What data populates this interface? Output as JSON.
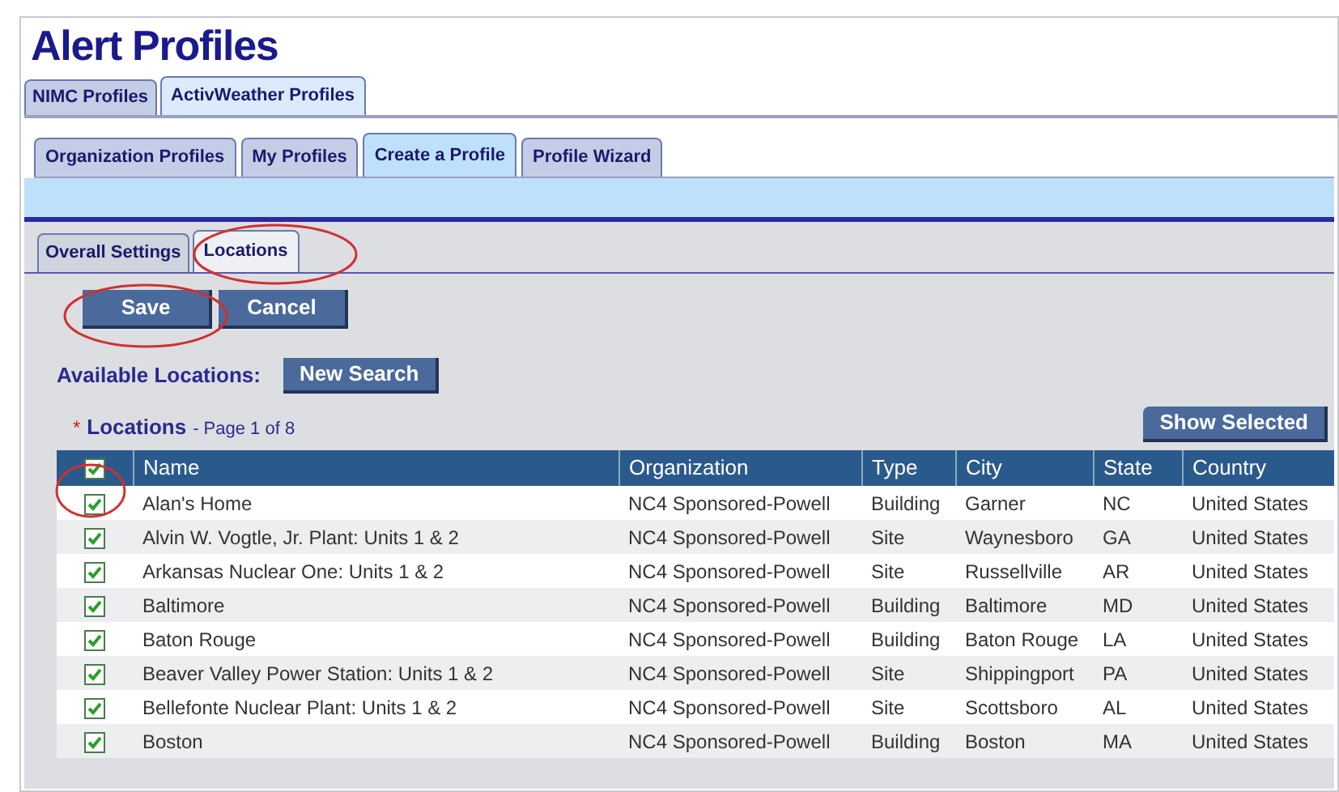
{
  "title": "Alert Profiles",
  "top_tabs": [
    {
      "label": "NIMC Profiles",
      "selected": false
    },
    {
      "label": "ActivWeather Profiles",
      "selected": true
    }
  ],
  "profile_tabs": [
    {
      "label": "Organization Profiles",
      "selected": false
    },
    {
      "label": "My Profiles",
      "selected": false
    },
    {
      "label": "Create a Profile",
      "selected": true
    },
    {
      "label": "Profile Wizard",
      "selected": false
    }
  ],
  "sub_tabs": [
    {
      "label": "Overall Settings",
      "selected": false
    },
    {
      "label": "Locations",
      "selected": true
    }
  ],
  "buttons": [
    "Save",
    "Cancel"
  ],
  "available_label": "Available Locations:",
  "new_search": "New Search",
  "required_mark": "*",
  "locations_title": "Locations",
  "page_info": "- Page 1 of 8",
  "show_selected": "Show Selected",
  "table": {
    "all_checked": true,
    "columns": [
      "Name",
      "Organization",
      "Type",
      "City",
      "State",
      "Country"
    ],
    "rows": [
      {
        "checked": true,
        "cells": [
          "Alan's Home",
          "NC4 Sponsored-Powell",
          "Building",
          "Garner",
          "NC",
          "United States"
        ]
      },
      {
        "checked": true,
        "cells": [
          "Alvin W. Vogtle, Jr. Plant: Units 1 & 2",
          "NC4 Sponsored-Powell",
          "Site",
          "Waynesboro",
          "GA",
          "United States"
        ]
      },
      {
        "checked": true,
        "cells": [
          "Arkansas Nuclear One: Units 1 & 2",
          "NC4 Sponsored-Powell",
          "Site",
          "Russellville",
          "AR",
          "United States"
        ]
      },
      {
        "checked": true,
        "cells": [
          "Baltimore",
          "NC4 Sponsored-Powell",
          "Building",
          "Baltimore",
          "MD",
          "United States"
        ]
      },
      {
        "checked": true,
        "cells": [
          "Baton Rouge",
          "NC4 Sponsored-Powell",
          "Building",
          "Baton Rouge",
          "LA",
          "United States"
        ]
      },
      {
        "checked": true,
        "cells": [
          "Beaver Valley Power Station: Units 1 & 2",
          "NC4 Sponsored-Powell",
          "Site",
          "Shippingport",
          "PA",
          "United States"
        ]
      },
      {
        "checked": true,
        "cells": [
          "Bellefonte Nuclear Plant: Units 1 & 2",
          "NC4 Sponsored-Powell",
          "Site",
          "Scottsboro",
          "AL",
          "United States"
        ]
      },
      {
        "checked": true,
        "cells": [
          "Boston",
          "NC4 Sponsored-Powell",
          "Building",
          "Boston",
          "MA",
          "United States"
        ]
      }
    ]
  }
}
